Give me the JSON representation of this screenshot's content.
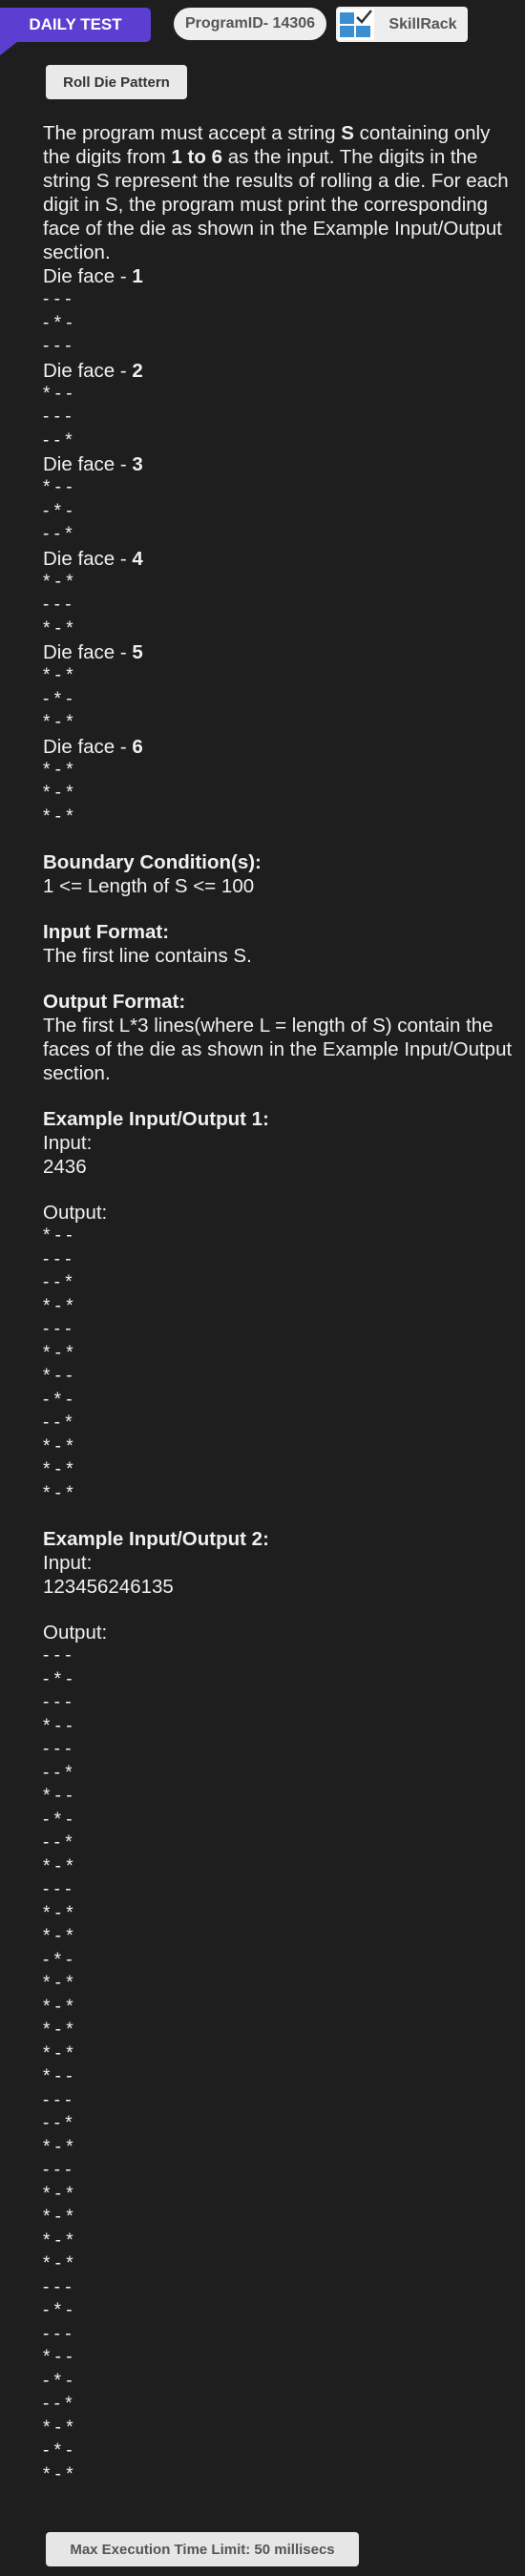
{
  "header": {
    "daily_test": "DAILY TEST",
    "program_id": "ProgramID- 14306",
    "skillrack": "SkillRack",
    "colors": {
      "daily_badge": "#5c3fd0",
      "pill_bg": "#eeeeee",
      "page_bg": "#1e1e1e"
    }
  },
  "problem": {
    "title": "Roll Die Pattern",
    "desc": [
      {
        "t": "The program must accept a string ",
        "b": false
      },
      {
        "t": "S",
        "b": true
      },
      {
        "t": " containing only the digits from ",
        "b": false
      },
      {
        "t": "1 to 6",
        "b": true
      },
      {
        "t": " as the input. The digits in the string S represent the results of rolling a die. For each digit in S, the program must print the corresponding face of the die as shown in the Example Input/Output section.",
        "b": false
      }
    ],
    "faces": [
      {
        "label": "Die face - ",
        "num": "1",
        "rows": [
          "- - -",
          "- * -",
          "- - -"
        ]
      },
      {
        "label": "Die face - ",
        "num": "2",
        "rows": [
          "* - -",
          "- - -",
          "- - *"
        ]
      },
      {
        "label": "Die face - ",
        "num": "3",
        "rows": [
          "* - -",
          "- * -",
          "- - *"
        ]
      },
      {
        "label": "Die face - ",
        "num": "4",
        "rows": [
          "* - *",
          "- - -",
          "* - *"
        ]
      },
      {
        "label": "Die face - ",
        "num": "5",
        "rows": [
          "* - *",
          "- * -",
          "* - *"
        ]
      },
      {
        "label": "Die face - ",
        "num": "6",
        "rows": [
          "* - *",
          "* - *",
          "* - *"
        ]
      }
    ],
    "boundary_heading": "Boundary Condition(s):",
    "boundary_text": "1 <= Length of S <= 100",
    "input_heading": "Input Format:",
    "input_text": "The first line contains S.",
    "output_heading": "Output Format:",
    "output_text": "The first L*3 lines(where L = length of S) contain the faces of the die as shown in the Example Input/Output section.",
    "examples": [
      {
        "heading": "Example Input/Output 1:",
        "input_label": "Input:",
        "input_value": "2436",
        "output_label": "Output:",
        "output_rows": [
          "* - -",
          "- - -",
          "- - *",
          "* - *",
          "- - -",
          "* - *",
          "* - -",
          "- * -",
          "- - *",
          "* - *",
          "* - *",
          "* - *"
        ]
      },
      {
        "heading": "Example Input/Output 2:",
        "input_label": "Input:",
        "input_value": "123456246135",
        "output_label": "Output:",
        "output_rows": [
          "- - -",
          "- * -",
          "- - -",
          "* - -",
          "- - -",
          "- - *",
          "* - -",
          "- * -",
          "- - *",
          "* - *",
          "- - -",
          "* - *",
          "* - *",
          "- * -",
          "* - *",
          "* - *",
          "* - *",
          "* - *",
          "* - -",
          "- - -",
          "- - *",
          "* - *",
          "- - -",
          "* - *",
          "* - *",
          "* - *",
          "* - *",
          "- - -",
          "- * -",
          "- - -",
          "* - -",
          "- * -",
          "- - *",
          "* - *",
          "- * -",
          "* - *"
        ]
      }
    ],
    "time_limit": "Max Execution Time Limit: 50 millisecs"
  }
}
